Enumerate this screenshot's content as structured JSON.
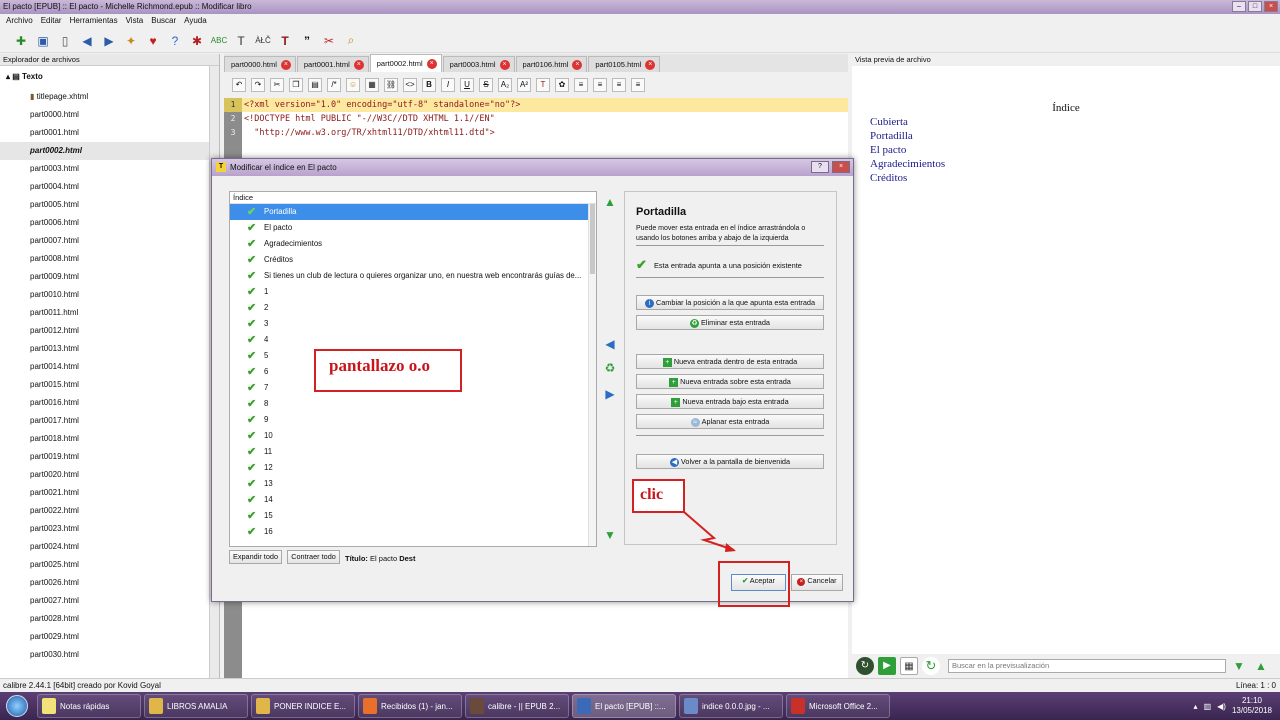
{
  "app": {
    "window_title": "El pacto [EPUB] :: El pacto - Michelle Richmond.epub :: Modificar libro",
    "menu": [
      "Archivo",
      "Editar",
      "Herramientas",
      "Vista",
      "Buscar",
      "Ayuda"
    ]
  },
  "explorer": {
    "header": "Explorador de archivos",
    "root": "Texto",
    "files": [
      "titlepage.xhtml",
      "part0000.html",
      "part0001.html",
      "part0002.html",
      "part0003.html",
      "part0004.html",
      "part0005.html",
      "part0006.html",
      "part0007.html",
      "part0008.html",
      "part0009.html",
      "part0010.html",
      "part0011.html",
      "part0012.html",
      "part0013.html",
      "part0014.html",
      "part0015.html",
      "part0016.html",
      "part0017.html",
      "part0018.html",
      "part0019.html",
      "part0020.html",
      "part0021.html",
      "part0022.html",
      "part0023.html",
      "part0024.html",
      "part0025.html",
      "part0026.html",
      "part0027.html",
      "part0028.html",
      "part0029.html",
      "part0030.html"
    ],
    "selected_file": "part0002.html"
  },
  "editor": {
    "tabs": [
      "part0000.html",
      "part0001.html",
      "part0002.html",
      "part0003.html",
      "part0106.html",
      "part0105.html"
    ],
    "active_tab": "part0002.html",
    "line_numbers": [
      "1",
      "2",
      "3"
    ],
    "code_lines": [
      "<?xml version=\"1.0\" encoding=\"utf-8\" standalone=\"no\"?>",
      "<!DOCTYPE html PUBLIC \"-//W3C//DTD XHTML 1.1//EN\"",
      "  \"http://www.w3.org/TR/xhtml11/DTD/xhtml11.dtd\">"
    ]
  },
  "preview": {
    "header": "Vista previa de archivo",
    "title": "Índice",
    "links": [
      "Cubierta",
      "Portadilla",
      "El pacto",
      "Agradecimientos",
      "Créditos"
    ],
    "search_placeholder": "Buscar en la previsualización"
  },
  "statusbar": {
    "left": "calibre 2.44.1 [64bit] creado por Kovid Goyal",
    "right": "Línea: 1 : 0"
  },
  "dialog": {
    "title": "Modificar el índice en El pacto",
    "tree_header": "Índice",
    "entries": [
      "Portadilla",
      "El pacto",
      "Agradecimientos",
      "Créditos",
      "Si tienes un club de lectura o quieres organizar uno, en nuestra web encontrarás guías de...",
      "1",
      "2",
      "3",
      "4",
      "5",
      "6",
      "7",
      "8",
      "9",
      "10",
      "11",
      "12",
      "13",
      "14",
      "15",
      "16"
    ],
    "selected_entry": "Portadilla",
    "panel": {
      "heading": "Portadilla",
      "description": "Puede mover esta entrada en el índice arrastrándola o usando los botones arriba y abajo de la izquierda",
      "status": "Esta entrada apunta a una posición existente",
      "buttons": {
        "change_target": "Cambiar la posición a la que apunta esta entrada",
        "delete": "Eliminar esta entrada",
        "new_inside": "Nueva entrada dentro de esta entrada",
        "new_above": "Nueva entrada sobre esta entrada",
        "new_below": "Nueva entrada bajo esta entrada",
        "flatten": "Aplanar esta entrada",
        "back": "Volver a la pantalla de bienvenida"
      }
    },
    "expand_all": "Expandir todo",
    "collapse_all": "Contraer todo",
    "title_label": "Título:",
    "title_value": "El pacto",
    "title_suffix": "Dest",
    "ok": "Aceptar",
    "cancel": "Cancelar"
  },
  "annotations": {
    "screenshot_note": "pantallazo o.o",
    "click_note": "clic"
  },
  "taskbar": {
    "items": [
      "Notas rápidas",
      "LIBROS AMALIA",
      "PONER INDICE E...",
      "Recibidos (1) - jan...",
      "calibre - || EPUB 2...",
      "El pacto [EPUB] ::...",
      "indice 0.0.0.jpg - ...",
      "Microsoft Office 2..."
    ],
    "active_item": "El pacto [EPUB] ::...",
    "time": "21:10",
    "date": "13/05/2018"
  },
  "colors": {
    "accent": "#3d8ee8",
    "annotation_red": "#d42020",
    "check_green": "#3aa02e",
    "code_highlight": "#fde8a0"
  }
}
